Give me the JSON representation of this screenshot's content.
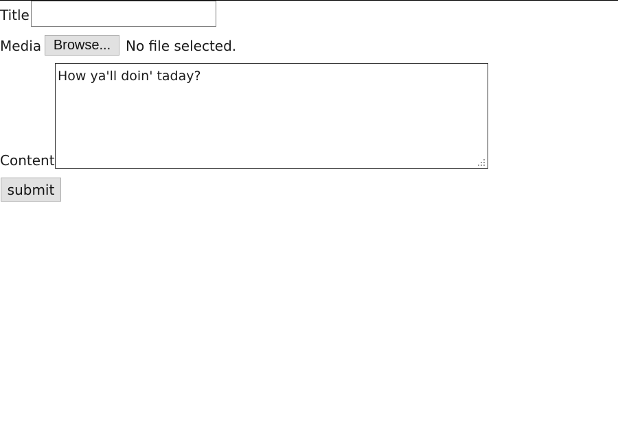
{
  "form": {
    "title": {
      "label": "Title",
      "value": ""
    },
    "media": {
      "label": "Media",
      "browse_label": "Browse...",
      "status_text": "No file selected."
    },
    "content": {
      "label": "Content",
      "value": "How ya'll doin' taday?"
    },
    "submit_label": "submit"
  }
}
